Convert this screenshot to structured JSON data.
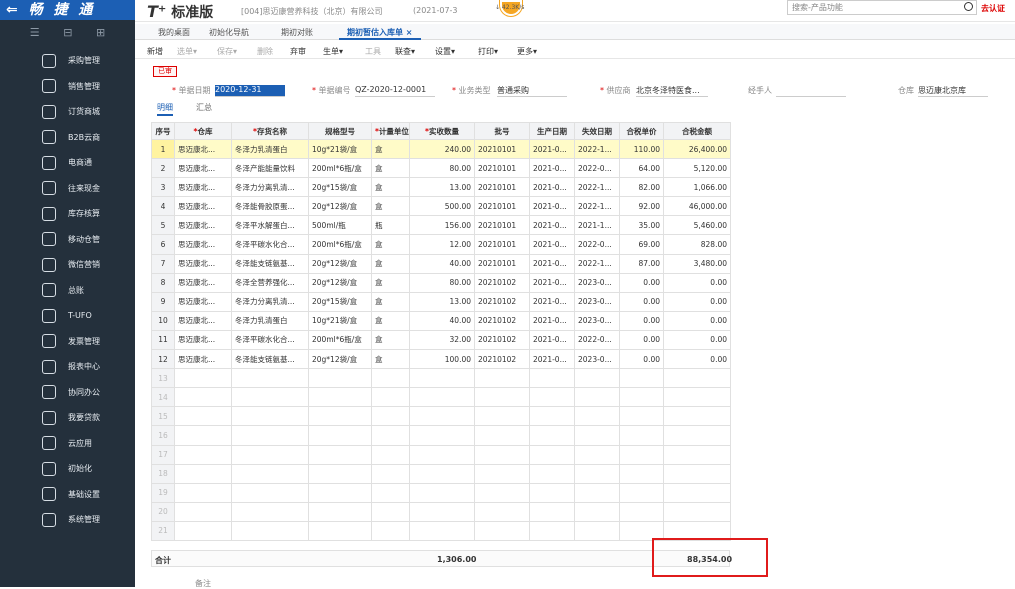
{
  "app": {
    "logo": "⇐ 畅 捷 通",
    "brand_mark": "T⁺",
    "brand_name": "标准版",
    "company": "[004]思迈康营养科技（北京）有限公司",
    "date": "(2021-07-3",
    "speed": "↓ 42.3K/s",
    "search_placeholder": "搜索-产品功能",
    "auth": "去认证"
  },
  "sidebar": {
    "tools": [
      "☰",
      "⊟",
      "⊞"
    ],
    "items": [
      {
        "label": "采购管理"
      },
      {
        "label": "销售管理"
      },
      {
        "label": "订货商城"
      },
      {
        "label": "B2B云商"
      },
      {
        "label": "电商通"
      },
      {
        "label": "往来现金"
      },
      {
        "label": "库存核算"
      },
      {
        "label": "移动仓管"
      },
      {
        "label": "微信营销"
      },
      {
        "label": "总账"
      },
      {
        "label": "T-UFO"
      },
      {
        "label": "发票管理"
      },
      {
        "label": "报表中心"
      },
      {
        "label": "协同办公"
      },
      {
        "label": "我要贷款"
      },
      {
        "label": "云应用"
      },
      {
        "label": "初始化"
      },
      {
        "label": "基础设置"
      },
      {
        "label": "系统管理"
      }
    ]
  },
  "tabs": [
    "我的桌面",
    "初始化导航",
    "期初对账",
    "期初暂估入库单 ×"
  ],
  "toolbar": [
    "新增",
    "选单▾",
    "保存▾",
    "删除",
    "弃审",
    "生单▾",
    "工具",
    "联查▾",
    "设置▾",
    "打印▾",
    "更多▾"
  ],
  "form": {
    "status": "已审",
    "date_label": "单据日期",
    "date_value": "2020-12-31",
    "code_label": "单据编号",
    "code_value": "QZ-2020-12-0001",
    "type_label": "业务类型",
    "type_value": "普通采购",
    "supplier_label": "供应商",
    "supplier_value": "北京冬泽特医食...",
    "handler_label": "经手人",
    "handler_value": "",
    "warehouse_label": "仓库",
    "warehouse_value": "思迈康北京库"
  },
  "subtabs": [
    "明细",
    "汇总"
  ],
  "grid": {
    "headers": [
      "序号",
      "仓库",
      "存货名称",
      "规格型号",
      "计量单位",
      "实收数量",
      "批号",
      "生产日期",
      "失效日期",
      "合税单价",
      "合税金额"
    ],
    "required": [
      false,
      true,
      true,
      false,
      true,
      true,
      false,
      false,
      false,
      false,
      false
    ],
    "rows": [
      [
        "1",
        "思迈康北...",
        "冬泽力乳清蛋白",
        "10g*21袋/盒",
        "盒",
        "240.00",
        "20210101",
        "2021-0...",
        "2022-1...",
        "110.00",
        "26,400.00"
      ],
      [
        "2",
        "思迈康北...",
        "冬泽产能能量饮料",
        "200ml*6瓶/盒",
        "盒",
        "80.00",
        "20210101",
        "2021-0...",
        "2022-0...",
        "64.00",
        "5,120.00"
      ],
      [
        "3",
        "思迈康北...",
        "冬泽力分离乳清...",
        "20g*15袋/盒",
        "盒",
        "13.00",
        "20210101",
        "2021-0...",
        "2022-1...",
        "82.00",
        "1,066.00"
      ],
      [
        "4",
        "思迈康北...",
        "冬泽能骨胶原蛋...",
        "20g*12袋/盒",
        "盒",
        "500.00",
        "20210101",
        "2021-0...",
        "2022-1...",
        "92.00",
        "46,000.00"
      ],
      [
        "5",
        "思迈康北...",
        "冬泽平水解蛋白...",
        "500ml/瓶",
        "瓶",
        "156.00",
        "20210101",
        "2021-0...",
        "2021-1...",
        "35.00",
        "5,460.00"
      ],
      [
        "6",
        "思迈康北...",
        "冬泽平碳水化合...",
        "200ml*6瓶/盒",
        "盒",
        "12.00",
        "20210101",
        "2021-0...",
        "2022-0...",
        "69.00",
        "828.00"
      ],
      [
        "7",
        "思迈康北...",
        "冬泽能支链氨基...",
        "20g*12袋/盒",
        "盒",
        "40.00",
        "20210101",
        "2021-0...",
        "2022-1...",
        "87.00",
        "3,480.00"
      ],
      [
        "8",
        "思迈康北...",
        "冬泽全营养强化...",
        "20g*12袋/盒",
        "盒",
        "80.00",
        "20210102",
        "2021-0...",
        "2023-0...",
        "0.00",
        "0.00"
      ],
      [
        "9",
        "思迈康北...",
        "冬泽力分离乳清...",
        "20g*15袋/盒",
        "盒",
        "13.00",
        "20210102",
        "2021-0...",
        "2023-0...",
        "0.00",
        "0.00"
      ],
      [
        "10",
        "思迈康北...",
        "冬泽力乳清蛋白",
        "10g*21袋/盒",
        "盒",
        "40.00",
        "20210102",
        "2021-0...",
        "2023-0...",
        "0.00",
        "0.00"
      ],
      [
        "11",
        "思迈康北...",
        "冬泽平碳水化合...",
        "200ml*6瓶/盒",
        "盒",
        "32.00",
        "20210102",
        "2021-0...",
        "2022-0...",
        "0.00",
        "0.00"
      ],
      [
        "12",
        "思迈康北...",
        "冬泽能支链氨基...",
        "20g*12袋/盒",
        "盒",
        "100.00",
        "20210102",
        "2021-0...",
        "2023-0...",
        "0.00",
        "0.00"
      ]
    ],
    "empty_rows": [
      "13",
      "14",
      "15",
      "16",
      "17",
      "18",
      "19",
      "20",
      "21"
    ],
    "total_label": "合计",
    "total_qty": "1,306.00",
    "total_amount": "88,354.00"
  },
  "remark_label": "备注",
  "colors": {
    "sidebar": "#24303c",
    "logo_bar": "#1c5fb4",
    "accent": "#1c5fb4",
    "highlight_box": "#e01b1b",
    "selected_row": "#fffbc8"
  }
}
